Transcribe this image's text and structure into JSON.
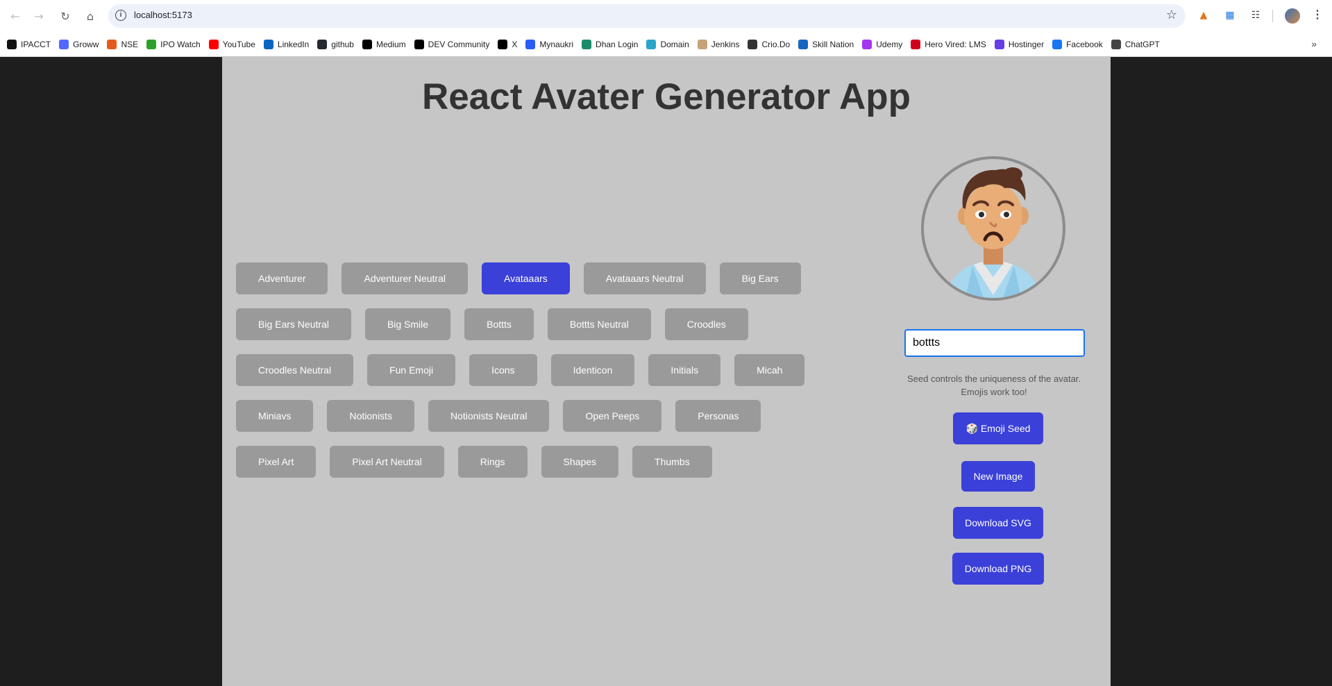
{
  "browser": {
    "url": "localhost:5173",
    "bookmarks": [
      {
        "label": "IPACCT",
        "icon": "ipacct-icon",
        "color": "#111111"
      },
      {
        "label": "Groww",
        "icon": "groww-icon",
        "color": "#5367ff"
      },
      {
        "label": "NSE",
        "icon": "nse-icon",
        "color": "#e55a1b"
      },
      {
        "label": "IPO Watch",
        "icon": "ipo-watch-icon",
        "color": "#2ca02c"
      },
      {
        "label": "YouTube",
        "icon": "youtube-icon",
        "color": "#ff0000"
      },
      {
        "label": "LinkedIn",
        "icon": "linkedin-icon",
        "color": "#0a66c2"
      },
      {
        "label": "github",
        "icon": "github-icon",
        "color": "#24292f"
      },
      {
        "label": "Medium",
        "icon": "medium-icon",
        "color": "#000000"
      },
      {
        "label": "DEV Community",
        "icon": "dev-icon",
        "color": "#000000"
      },
      {
        "label": "X",
        "icon": "x-icon",
        "color": "#000000"
      },
      {
        "label": "Mynaukri",
        "icon": "naukri-icon",
        "color": "#275df5"
      },
      {
        "label": "Dhan Login",
        "icon": "dhan-icon",
        "color": "#1d8c6a"
      },
      {
        "label": "Domain",
        "icon": "domain-icon",
        "color": "#2aa5c8"
      },
      {
        "label": "Jenkins",
        "icon": "jenkins-icon",
        "color": "#c7a17a"
      },
      {
        "label": "Crio.Do",
        "icon": "crio-icon",
        "color": "#333333"
      },
      {
        "label": "Skill Nation",
        "icon": "skill-nation-icon",
        "color": "#1565c0"
      },
      {
        "label": "Udemy",
        "icon": "udemy-icon",
        "color": "#a435f0"
      },
      {
        "label": "Hero Vired: LMS",
        "icon": "hero-vired-icon",
        "color": "#d0021b"
      },
      {
        "label": "Hostinger",
        "icon": "hostinger-icon",
        "color": "#673de6"
      },
      {
        "label": "Facebook",
        "icon": "facebook-icon",
        "color": "#1877f2"
      },
      {
        "label": "ChatGPT",
        "icon": "chatgpt-icon",
        "color": "#444444"
      }
    ]
  },
  "app": {
    "title": "React Avater Generator App",
    "accent_color": "#3b40d9",
    "inactive_color": "#9a9a9a",
    "style_rows": [
      [
        {
          "label": "Adventurer",
          "active": false
        },
        {
          "label": "Adventurer Neutral",
          "active": false
        },
        {
          "label": "Avataaars",
          "active": true
        },
        {
          "label": "Avataaars Neutral",
          "active": false
        },
        {
          "label": "Big Ears",
          "active": false
        }
      ],
      [
        {
          "label": "Big Ears Neutral",
          "active": false
        },
        {
          "label": "Big Smile",
          "active": false
        },
        {
          "label": "Bottts",
          "active": false
        },
        {
          "label": "Bottts Neutral",
          "active": false
        },
        {
          "label": "Croodles",
          "active": false
        }
      ],
      [
        {
          "label": "Croodles Neutral",
          "active": false
        },
        {
          "label": "Fun Emoji",
          "active": false
        },
        {
          "label": "Icons",
          "active": false
        },
        {
          "label": "Identicon",
          "active": false
        },
        {
          "label": "Initials",
          "active": false
        },
        {
          "label": "Micah",
          "active": false
        }
      ],
      [
        {
          "label": "Miniavs",
          "active": false
        },
        {
          "label": "Notionists",
          "active": false
        },
        {
          "label": "Notionists Neutral",
          "active": false
        },
        {
          "label": "Open Peeps",
          "active": false
        },
        {
          "label": "Personas",
          "active": false
        }
      ],
      [
        {
          "label": "Pixel Art",
          "active": false
        },
        {
          "label": "Pixel Art Neutral",
          "active": false
        },
        {
          "label": "Rings",
          "active": false
        },
        {
          "label": "Shapes",
          "active": false
        },
        {
          "label": "Thumbs",
          "active": false
        }
      ]
    ],
    "seed": {
      "value": "bottts",
      "hint": "Seed controls the uniqueness of the avatar. Emojis work too!"
    },
    "actions": {
      "emoji_seed": "🎲 Emoji Seed",
      "new_image": "New Image",
      "download_svg": "Download SVG",
      "download_png": "Download PNG"
    }
  }
}
